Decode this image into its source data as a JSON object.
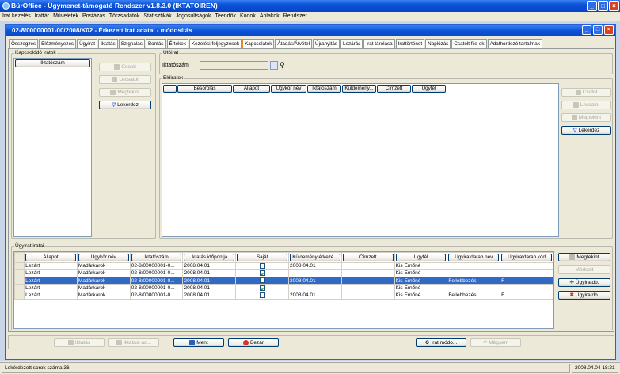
{
  "app": {
    "title": "BürOffice - Ügymenet-támogató Rendszer v1.8.3.0 (IKTATOIREN)"
  },
  "menu": [
    "Irat kezelés",
    "Irattár",
    "Műveletek",
    "Postázás",
    "Törzsadatok",
    "Statisztikák",
    "Jogosultságok",
    "Teendők",
    "Kódok",
    "Ablakok",
    "Rendszer"
  ],
  "child": {
    "title": "02-8/00000001-00/2008/K02 - Érkezett irat adatai - módosítás"
  },
  "tabs": [
    "Összegzés",
    "Előzményezés",
    "Ügyirat",
    "Iktatás",
    "Szignálás",
    "Bontás",
    "Értékek",
    "Kezelési feljegyzések",
    "Kapcsolatok",
    "Átadás/Átvétel",
    "Újranyitás",
    "Lezárás",
    "Irat tárolása",
    "Irattörténet",
    "Naplózás",
    "Csatolt file-ok",
    "Adathordozó tartalmak"
  ],
  "active_tab": "Kapcsolatok",
  "kapcsolodo": {
    "label": "Kapcsolódó iratok",
    "header": "Iktatószám",
    "btn_csatol": "Csatol",
    "btn_lecsatol": "Lecsatol",
    "btn_megtekint": "Megtekint",
    "btn_lekerdez": "Lekérdez"
  },
  "utoirat": {
    "label": "Utóirat",
    "field_label": "Iktatószám",
    "value": ""
  },
  "eloiratok": {
    "label": "Előiratok",
    "headers": [
      "Besorolás",
      "Állapot",
      "Ügykör név",
      "Iktatószám",
      "Küldemény...",
      "Címzett",
      "Ügyfél"
    ],
    "btn_csatol": "Csatol",
    "btn_lecsatol": "Lecsatol",
    "btn_megtekint": "Megtekint",
    "btn_lekerdez": "Lekérdez"
  },
  "ugyirat": {
    "label": "Ügyirat iratai",
    "headers": [
      "Állapot",
      "Ügykör név",
      "Iktatószám",
      "Iktatás időpontja",
      "Saját",
      "Küldemény érkezé...",
      "Címzett",
      "Ügyfél",
      "Ügyiratdarab név",
      "Ügyiratdarab kód"
    ],
    "rows": [
      {
        "allapot": "Lezárt",
        "ugykor": "Madárkárok",
        "iktatoszam": "02-8/00000001-0...",
        "ido": "2008.04.01",
        "sajat": false,
        "kuldemeny": "2008.04.01",
        "cimzett": "",
        "ugyfel": "Kis Ernőné",
        "darabnev": "",
        "darabkod": ""
      },
      {
        "allapot": "Lezárt",
        "ugykor": "Madárkárok",
        "iktatoszam": "02-8/00000001-0...",
        "ido": "2008.04.01",
        "sajat": true,
        "kuldemeny": "",
        "cimzett": "",
        "ugyfel": "Kis Ernőné",
        "darabnev": "",
        "darabkod": ""
      },
      {
        "allapot": "Lezárt",
        "ugykor": "Madárkárok",
        "iktatoszam": "02-8/00000001-0...",
        "ido": "2008.04.01",
        "sajat": false,
        "kuldemeny": "2008.04.01",
        "cimzett": "",
        "ugyfel": "Kis Ernőné",
        "darabnev": "Fellebbezés",
        "darabkod": "F"
      },
      {
        "allapot": "Lezárt",
        "ugykor": "Madárkárok",
        "iktatoszam": "02-8/00000001-0...",
        "ido": "2008.04.01",
        "sajat": true,
        "kuldemeny": "",
        "cimzett": "",
        "ugyfel": "Kis Ernőné",
        "darabnev": "",
        "darabkod": ""
      },
      {
        "allapot": "Lezárt",
        "ugykor": "Madárkárok",
        "iktatoszam": "02-8/00000001-0...",
        "ido": "2008.04.01",
        "sajat": false,
        "kuldemeny": "2008.04.01",
        "cimzett": "",
        "ugyfel": "Kis Ernőné",
        "darabnev": "Fellebbezés",
        "darabkod": "F"
      }
    ],
    "selected_row": 2,
    "btn_megtekint": "Megtekint",
    "btn_modosit": "Módosít",
    "btn_add": "Ügyiratdb.",
    "btn_remove": "Ügyiratdb."
  },
  "bottom": {
    "iktatas": "Iktatás",
    "iktatasi": "Iktatási ad...",
    "ment": "Ment",
    "bezar": "Bezár",
    "irat_modo": "Irat módo...",
    "megsem": "Mégsem"
  },
  "status": {
    "left": "Lekérdezett sorok száma 36",
    "right": "2008.04.04 18:21"
  }
}
